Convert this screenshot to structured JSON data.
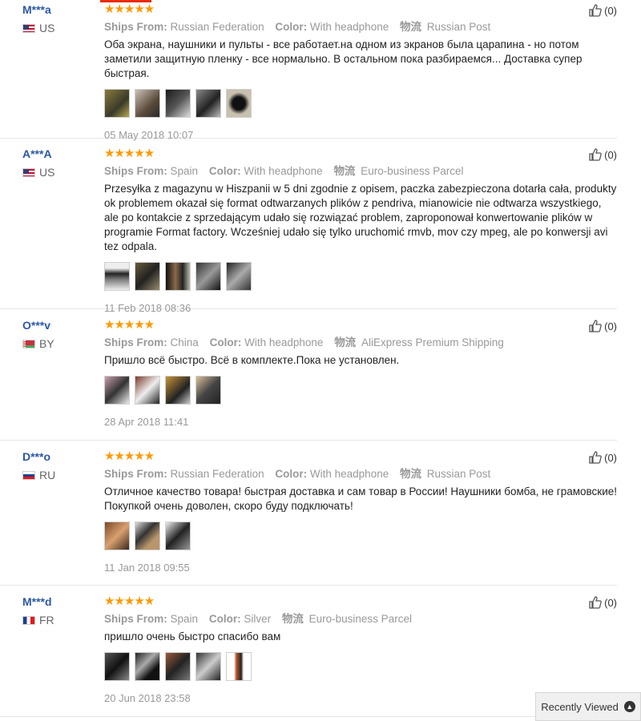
{
  "labels": {
    "ships_from": "Ships From:",
    "color": "Color:",
    "logistics": "物流"
  },
  "reviews": [
    {
      "username": "M***a",
      "country": "US",
      "flag": "us",
      "stars": "★★★★★",
      "ships_from": "Russian Federation",
      "color": "With headphone",
      "logistics": "Russian Post",
      "text": "Оба экрана, наушники и пульты - все работает.на одном из экранов была царапина - но потом заметили защитную пленку - все нормально. В остальном пока разбираемся... Доставка супер быстрая.",
      "photo_count": 5,
      "date": "05 May 2018 10:07",
      "helpful": "(0)"
    },
    {
      "username": "A***A",
      "country": "US",
      "flag": "us",
      "stars": "★★★★★",
      "ships_from": "Spain",
      "color": "With headphone",
      "logistics": "Euro-business Parcel",
      "text": "Przesyłka z magazynu w Hiszpanii w 5 dni zgodnie z opisem, paczka zabezpieczona dotarła cała, produkty ok problemem okazał się format odtwarzanych plików z pendriva, mianowicie nie odtwarza wszystkiego, ale po kontakcie z sprzedającym udało się rozwiązać problem, zaproponował konwertowanie plików w programie Format factory. Wcześniej udało się tylko uruchomić rmvb, mov czy mpeg, ale po konwersji avi tez odpala.",
      "photo_count": 5,
      "date": "11 Feb 2018 08:36",
      "helpful": "(0)"
    },
    {
      "username": "O***v",
      "country": "BY",
      "flag": "by",
      "stars": "★★★★★",
      "ships_from": "China",
      "color": "With headphone",
      "logistics": "AliExpress Premium Shipping",
      "text": "Пришло всё быстро. Всё в комплекте.Пока не установлен.",
      "photo_count": 4,
      "date": "28 Apr 2018 11:41",
      "helpful": "(0)"
    },
    {
      "username": "D***o",
      "country": "RU",
      "flag": "ru",
      "stars": "★★★★★",
      "ships_from": "Russian Federation",
      "color": "With headphone",
      "logistics": "Russian Post",
      "text": "Отличное качество товара! быстрая доставка и сам товар в России! Наушники бомба, не грамовские! Покупкой очень доволен, скоро буду подключать!",
      "photo_count": 3,
      "date": "11 Jan 2018 09:55",
      "helpful": "(0)"
    },
    {
      "username": "M***d",
      "country": "FR",
      "flag": "fr",
      "stars": "★★★★★",
      "ships_from": "Spain",
      "color": "Silver",
      "logistics": "Euro-business Parcel",
      "text": "пришло очень быстро спасибо вам",
      "photo_count": 5,
      "date": "20 Jun 2018 23:58",
      "helpful": "(0)"
    }
  ],
  "recently_viewed": {
    "label": "Recently Viewed",
    "icon": "chevron-up-icon"
  },
  "colors": {
    "username": "#2c58a6",
    "stars": "#ff9900",
    "meta": "#999999",
    "accent": "#e62e04"
  }
}
